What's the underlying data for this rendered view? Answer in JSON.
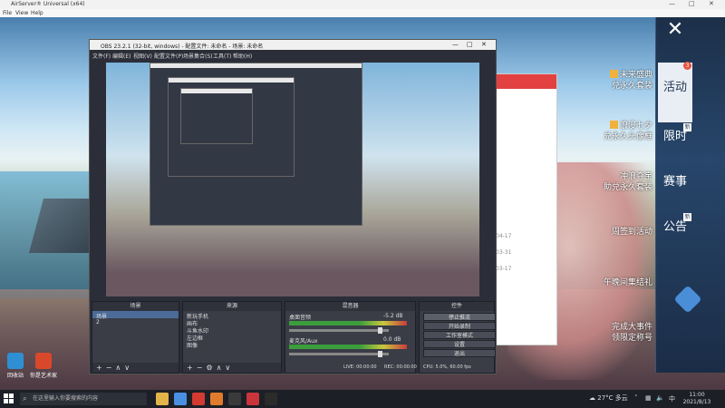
{
  "app": {
    "title": "AirServer® Universal (x64)",
    "menu": [
      "File",
      "View",
      "Help"
    ],
    "win_min": "—",
    "win_max": "□",
    "win_close": "✕"
  },
  "desktop": {
    "icons": [
      {
        "label": "回收站",
        "color": "#2f8fd3"
      },
      {
        "label": "你是艺术家",
        "color": "#d9482b"
      }
    ]
  },
  "obs": {
    "title": "OBS 23.2.1 (32-bit, windows) - 配置文件: 未命名 - 场景: 未命名",
    "menu": [
      "文件(F)",
      "编辑(E)",
      "视图(V)",
      "配置文件(P)",
      "场景集合(S)",
      "工具(T)",
      "帮助(H)"
    ],
    "docks": {
      "scenes": {
        "title": "场景",
        "items": [
          "场景",
          "2"
        ],
        "selected": 0
      },
      "sources": {
        "title": "来源",
        "items": [
          "新玩手机",
          "画布",
          "斗鱼水印",
          "左边框",
          "图像"
        ]
      },
      "mixer": {
        "title": "混音器",
        "tracks": [
          {
            "name": "桌面音频",
            "db": "-5.2 dB"
          },
          {
            "name": "麦克风/Aux",
            "db": "0.0 dB"
          }
        ]
      },
      "controls": {
        "title": "控件",
        "buttons": [
          "停止推流",
          "开始录制",
          "工作室模式",
          "设置",
          "退出"
        ],
        "highlight": 0
      }
    },
    "status": {
      "live": "LIVE: 00:00:00",
      "rec": "REC: 00:00:00",
      "cpu": "CPU: 5.0%, 60.00 fps"
    }
  },
  "side_panel": {
    "tabs": [
      {
        "label": "活动",
        "active": true,
        "badge": "3"
      },
      {
        "label": "限时",
        "active": false,
        "new": "新"
      },
      {
        "label": "赛事",
        "active": false
      },
      {
        "label": "公告",
        "active": false,
        "new": "新"
      }
    ],
    "rewards": [
      {
        "line1": "未来盛典",
        "line2": "兑永久套装",
        "icon": true
      },
      {
        "line1": "浪漫七夕",
        "line2": "兑永久头像框",
        "icon": true
      },
      {
        "line1": "冲浪夺宝",
        "line2": "助兑永久套装",
        "icon": false
      },
      {
        "line1": "周签到活动",
        "line2": "",
        "icon": false
      },
      {
        "line1": "午晚间集结礼",
        "line2": "",
        "icon": false
      },
      {
        "line1": "完成大事件",
        "line2": "领限定称号",
        "icon": false
      }
    ]
  },
  "background_window": {
    "rows": [
      "04-17",
      "03-31",
      "03-17"
    ]
  },
  "taskbar": {
    "search_placeholder": "在这里输入你要搜索的内容",
    "weather": "27°C 多云",
    "time": "11:00",
    "date": "2021/8/13",
    "apps": [
      {
        "name": "file-explorer",
        "color": "#e2b44a"
      },
      {
        "name": "browser",
        "color": "#4a90e2"
      },
      {
        "name": "netease-music",
        "color": "#d33a31"
      },
      {
        "name": "app-orange",
        "color": "#e07b2c"
      },
      {
        "name": "obs",
        "color": "#3a3a3a"
      },
      {
        "name": "app-red",
        "color": "#c9353b"
      },
      {
        "name": "terminal",
        "color": "#2b2b2b"
      }
    ]
  },
  "colors": {
    "accent": "#4b6c99",
    "panel": "#27466b",
    "red": "#e34141"
  }
}
